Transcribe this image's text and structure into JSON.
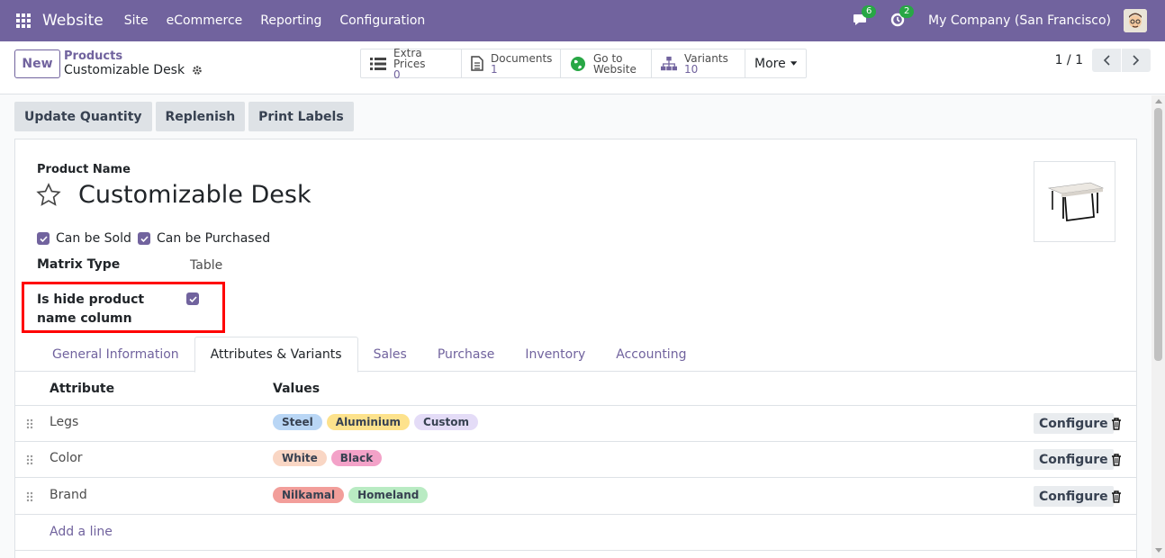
{
  "navbar": {
    "app_name": "Website",
    "menu": [
      "Site",
      "eCommerce",
      "Reporting",
      "Configuration"
    ],
    "messages_count": "6",
    "activities_count": "2",
    "company": "My Company (San Francisco)"
  },
  "control": {
    "new_label": "New",
    "breadcrumb_parent": "Products",
    "breadcrumb_current": "Customizable Desk",
    "smart_buttons": [
      {
        "label": "Extra Prices",
        "value": "0",
        "icon": "list-icon"
      },
      {
        "label": "Documents",
        "value": "1",
        "icon": "document-icon"
      },
      {
        "label": "Go to",
        "value": "Website",
        "icon": "globe-icon"
      },
      {
        "label": "Variants",
        "value": "10",
        "icon": "sitemap-icon"
      }
    ],
    "more_label": "More",
    "pager_value": "1 / 1"
  },
  "actions": [
    "Update Quantity",
    "Replenish",
    "Print Labels"
  ],
  "form": {
    "product_name_label": "Product Name",
    "product_name": "Customizable Desk",
    "can_be_sold_label": "Can be Sold",
    "can_be_purchased_label": "Can be Purchased",
    "matrix_type_label": "Matrix Type",
    "matrix_type_value": "Table",
    "hide_column_label": "Is hide product name column",
    "hide_column_checked": true
  },
  "tabs": [
    "General Information",
    "Attributes & Variants",
    "Sales",
    "Purchase",
    "Inventory",
    "Accounting"
  ],
  "active_tab": "Attributes & Variants",
  "table": {
    "headers": {
      "attribute": "Attribute",
      "values": "Values"
    },
    "rows": [
      {
        "attribute": "Legs",
        "values": [
          {
            "name": "Steel",
            "color": "#b9d6f5"
          },
          {
            "name": "Aluminium",
            "color": "#fde28c"
          },
          {
            "name": "Custom",
            "color": "#e4dcf7"
          }
        ]
      },
      {
        "attribute": "Color",
        "values": [
          {
            "name": "White",
            "color": "#f9d6c4"
          },
          {
            "name": "Black",
            "color": "#f3a2c8"
          }
        ]
      },
      {
        "attribute": "Brand",
        "values": [
          {
            "name": "Nilkamal",
            "color": "#f29e9a"
          },
          {
            "name": "Homeland",
            "color": "#b9ebc3"
          }
        ]
      }
    ],
    "configure_label": "Configure",
    "add_line_label": "Add a line"
  },
  "colors": {
    "brand": "#71639e",
    "badge": "#28a745",
    "highlight": "#ff0000"
  }
}
